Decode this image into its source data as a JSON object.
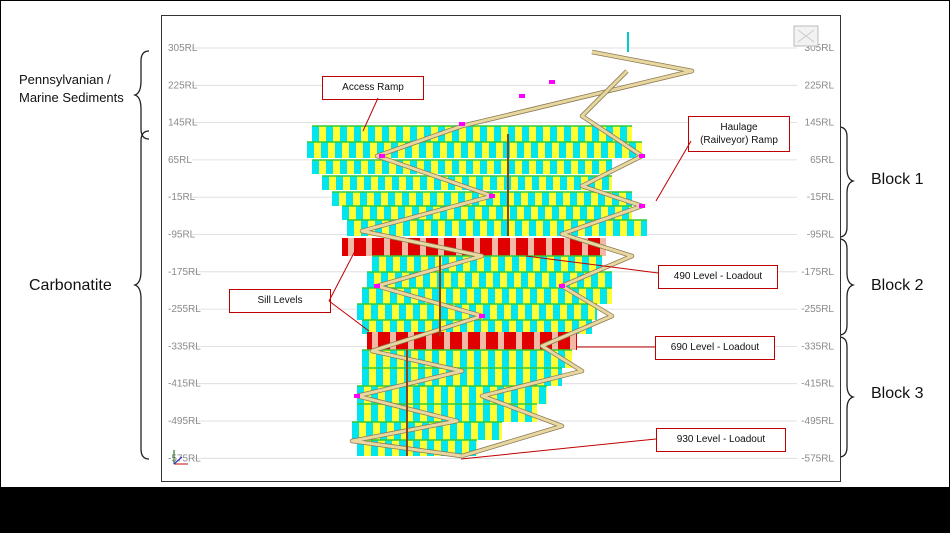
{
  "rl_levels": [
    "305RL",
    "225RL",
    "145RL",
    "65RL",
    "-15RL",
    "-95RL",
    "-175RL",
    "-255RL",
    "-335RL",
    "-415RL",
    "-495RL",
    "-575RL"
  ],
  "left_labels": {
    "sediments": "Pennsylvanian / Marine Sediments",
    "carbonatite": "Carbonatite"
  },
  "right_labels": {
    "block1": "Block 1",
    "block2": "Block 2",
    "block3": "Block 3"
  },
  "callouts": {
    "access_ramp": "Access Ramp",
    "haulage_ramp_line1": "Haulage",
    "haulage_ramp_line2": "(Railveyor) Ramp",
    "sill_levels": "Sill Levels",
    "loadout_490": "490 Level - Loadout",
    "loadout_690": "690 Level - Loadout",
    "loadout_930": "930 Level - Loadout"
  },
  "colors": {
    "callout_border": "#c00000",
    "stope_cyan": "#00e5ee",
    "stope_yellow": "#ffff33",
    "sill_red": "#e00000",
    "level_green": "#33cc33",
    "ramp_tan": "#e8d7a0",
    "marker_magenta": "#ff00ff"
  },
  "axis_icon": "xyz-axis-icon",
  "viewcube_icon": "view-cube-icon"
}
